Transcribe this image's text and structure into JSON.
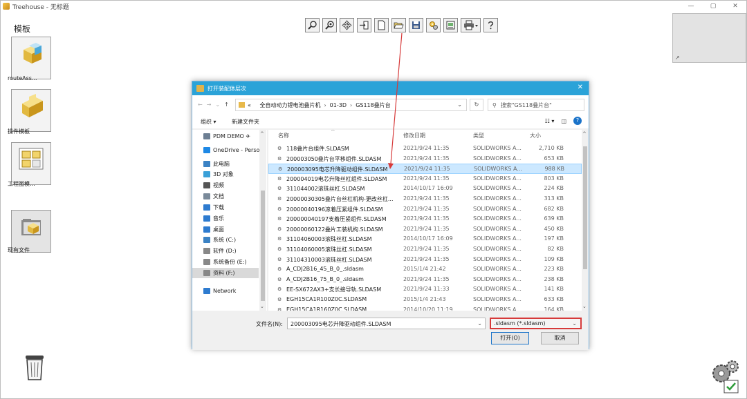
{
  "window": {
    "title": "Treehouse - 无标题",
    "controls": [
      "—",
      "▢",
      "✕"
    ]
  },
  "templates": {
    "heading": "模板",
    "items": [
      {
        "label": "routeAss..."
      },
      {
        "label": "操件模板"
      },
      {
        "label": "工程图模..."
      },
      {
        "label": "现有文件"
      }
    ]
  },
  "toolbar": {
    "buttons": [
      "zoom-icon",
      "zoom-fit-icon",
      "pan-icon",
      "import-icon",
      "new-document-icon",
      "open-folder-icon",
      "save-icon",
      "settings-icon",
      "export-icon",
      "print-icon",
      "help-icon"
    ]
  },
  "dialog": {
    "title": "打开装配体层次",
    "close": "✕",
    "address": {
      "segments": [
        "«",
        "全自动动力锂电池叠片机",
        "01-3D",
        "GS118叠片台"
      ]
    },
    "search_placeholder": "搜索\"GS118叠片台\"",
    "commands": {
      "organize": "组织 ▾",
      "new_folder": "新建文件夹"
    },
    "nav": [
      {
        "label": "PDM DEMO ✈",
        "color": "#6d7f93"
      },
      {
        "label": "OneDrive - Perso",
        "color": "#1e88e5"
      },
      {
        "label": "此电脑",
        "color": "#3b82c4"
      },
      {
        "label": "3D 对象",
        "color": "#3aa0d8"
      },
      {
        "label": "视频",
        "color": "#555555"
      },
      {
        "label": "文档",
        "color": "#7a8a9a"
      },
      {
        "label": "下载",
        "color": "#2e7bcf"
      },
      {
        "label": "音乐",
        "color": "#2e7bcf"
      },
      {
        "label": "桌面",
        "color": "#2e7bcf"
      },
      {
        "label": "系统 (C:)",
        "color": "#3b82c4"
      },
      {
        "label": "软件 (D:)",
        "color": "#888888"
      },
      {
        "label": "系统备份 (E:)",
        "color": "#888888"
      },
      {
        "label": "资料 (F:)",
        "color": "#888888"
      },
      {
        "label": "Network",
        "color": "#2e7bcf"
      }
    ],
    "columns": {
      "name": "名称",
      "date": "修改日期",
      "type": "类型",
      "size": "大小"
    },
    "files": [
      {
        "name": "118叠片台组件.SLDASM",
        "date": "2021/9/24 11:35",
        "type": "SOLIDWORKS A...",
        "size": "2,710 KB"
      },
      {
        "name": "200003050叠片台平移组件.SLDASM",
        "date": "2021/9/24 11:35",
        "type": "SOLIDWORKS A...",
        "size": "653 KB"
      },
      {
        "name": "200003095电芯升降驱动组件.SLDASM",
        "date": "2021/9/24 11:35",
        "type": "SOLIDWORKS A...",
        "size": "988 KB"
      },
      {
        "name": "200004019电芯升降丝杠组件.SLDASM",
        "date": "2021/9/24 11:35",
        "type": "SOLIDWORKS A...",
        "size": "803 KB"
      },
      {
        "name": "311044002滚珠丝杠.SLDASM",
        "date": "2014/10/17 16:09",
        "type": "SOLIDWORKS A...",
        "size": "224 KB"
      },
      {
        "name": "20000030305叠片台丝杠机构-更改丝杠...",
        "date": "2021/9/24 11:35",
        "type": "SOLIDWORKS A...",
        "size": "313 KB"
      },
      {
        "name": "20000040196凉着压紧组件.SLDASM",
        "date": "2021/9/24 11:35",
        "type": "SOLIDWORKS A...",
        "size": "682 KB"
      },
      {
        "name": "200000040197支着压紧组件.SLDASM",
        "date": "2021/9/24 11:35",
        "type": "SOLIDWORKS A...",
        "size": "639 KB"
      },
      {
        "name": "20000060122叠片工装机构.SLDASM",
        "date": "2021/9/24 11:35",
        "type": "SOLIDWORKS A...",
        "size": "450 KB"
      },
      {
        "name": "31104060003滚珠丝杠.SLDASM",
        "date": "2014/10/17 16:09",
        "type": "SOLIDWORKS A...",
        "size": "197 KB"
      },
      {
        "name": "31104060005滚珠丝杠.SLDASM",
        "date": "2021/9/24 11:35",
        "type": "SOLIDWORKS A...",
        "size": "82 KB"
      },
      {
        "name": "31104310003滚珠丝杠.SLDASM",
        "date": "2021/9/24 11:35",
        "type": "SOLIDWORKS A...",
        "size": "109 KB"
      },
      {
        "name": "A_CDJ2B16_45_B_0_.sldasm",
        "date": "2015/1/4 21:42",
        "type": "SOLIDWORKS A...",
        "size": "223 KB"
      },
      {
        "name": "A_CDJ2B16_75_B_0_.sldasm",
        "date": "2021/9/24 11:35",
        "type": "SOLIDWORKS A...",
        "size": "238 KB"
      },
      {
        "name": "EE-SX672AX3+支长接导轨.SLDASM",
        "date": "2021/9/24 11:33",
        "type": "SOLIDWORKS A...",
        "size": "141 KB"
      },
      {
        "name": "EGH15CA1R100Z0C.SLDASM",
        "date": "2015/1/4 21:43",
        "type": "SOLIDWORKS A...",
        "size": "633 KB"
      },
      {
        "name": "EGH15CA1R160Z0C.SLDASM",
        "date": "2014/10/20 11:19",
        "type": "SOLIDWORKS A...",
        "size": "164 KB"
      }
    ],
    "selected_index": 2,
    "filename_label": "文件名(N):",
    "filename_value": "200003095电芯升降驱动组件.SLDASM",
    "filter_value": ".sldasm (*.sldasm)",
    "open_label": "打开(O)",
    "cancel_label": "取消"
  },
  "colors": {
    "dialog_title_bar": "#2ba3d8",
    "selection": "#cce8ff",
    "highlight_box": "#d63a3a",
    "annotation_arrow": "#d63a3a"
  }
}
